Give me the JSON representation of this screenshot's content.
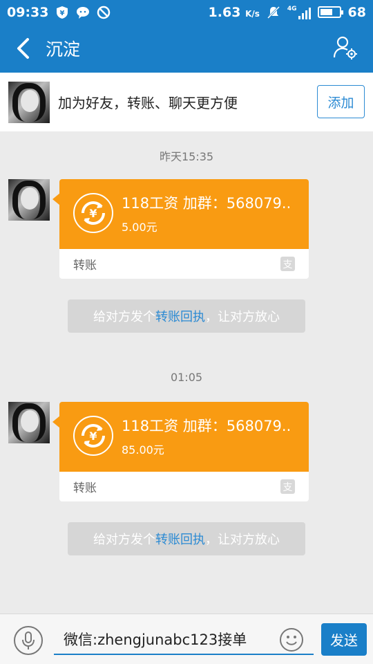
{
  "status_bar": {
    "time": "09:33",
    "speed": "1.63",
    "speed_unit": "K/s",
    "network": "4G",
    "battery": "68",
    "battery_level": 0.68
  },
  "header": {
    "title": "沉淀"
  },
  "friend_bar": {
    "text": "加为好友，转账、聊天更方便",
    "add_label": "添加"
  },
  "messages": [
    {
      "time": "昨天15:35",
      "title": "118工资 加群：568079..",
      "amount": "5.00元",
      "type_label": "转账",
      "receipt_before": "给对方发个",
      "receipt_link": "转账回执",
      "receipt_after": "，让对方放心"
    },
    {
      "time": "01:05",
      "title": "118工资 加群：568079..",
      "amount": "85.00元",
      "type_label": "转账",
      "receipt_before": "给对方发个",
      "receipt_link": "转账回执",
      "receipt_after": "，让对方放心"
    }
  ],
  "input_bar": {
    "value": "微信:zhengjunabc123接单",
    "send_label": "发送"
  },
  "icons": {
    "back": "back-arrow-icon",
    "profile": "profile-settings-icon",
    "coin": "yuan-coin-icon",
    "alipay": "alipay-icon",
    "mic": "microphone-icon",
    "emoji": "emoji-icon"
  },
  "colors": {
    "primary": "#1a7fc8",
    "card_orange": "#f99b12",
    "link_blue": "#2b8ad3"
  }
}
